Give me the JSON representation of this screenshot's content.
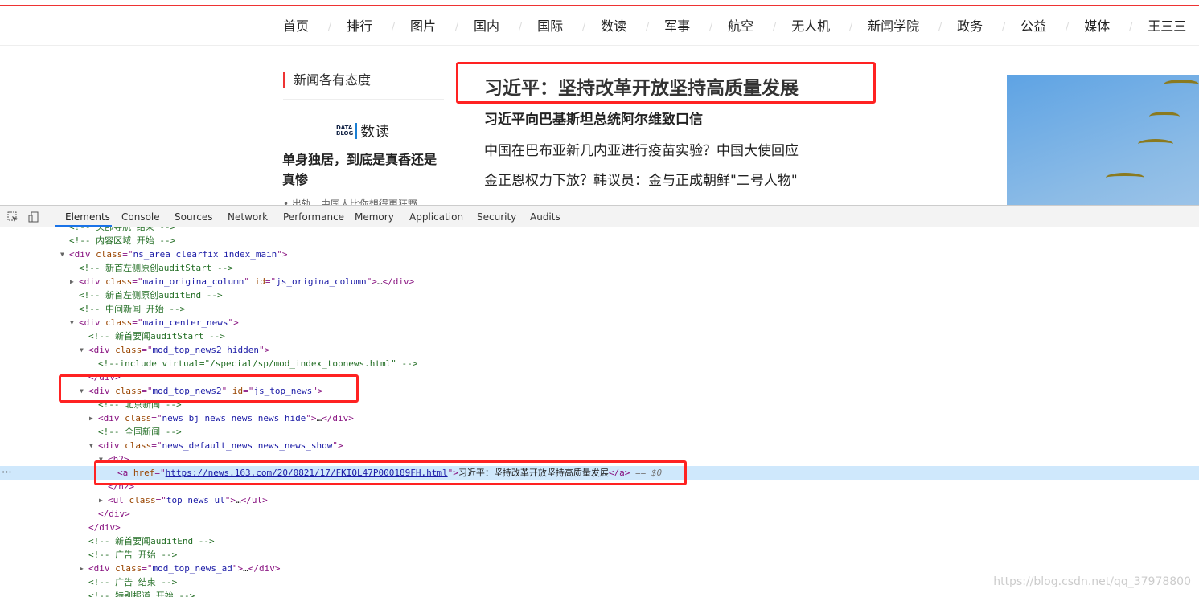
{
  "nav": [
    "首页",
    "排行",
    "图片",
    "国内",
    "国际",
    "数读",
    "军事",
    "航空",
    "无人机",
    "新闻学院",
    "政务",
    "公益",
    "媒体",
    "王三三"
  ],
  "left": {
    "title": "新闻各有态度",
    "logo_text": "DATA BLOG",
    "logo_label": "数读",
    "headline": "单身独居，到底是真香还是真惨",
    "sub": "• 出轨，中国人比你想得更狂野"
  },
  "center": {
    "headline": "习近平：坚持改革开放坚持高质量发展",
    "sub": "习近平向巴基斯坦总统阿尔维致口信",
    "news": [
      "中国在巴布亚新几内亚进行疫苗实验？中国大使回应",
      "金正恩权力下放？韩议员：金与正成朝鲜\"二号人物\""
    ]
  },
  "devtools": {
    "tabs": [
      "Elements",
      "Console",
      "Sources",
      "Network",
      "Performance",
      "Memory",
      "Application",
      "Security",
      "Audits"
    ],
    "active_tab": "Elements"
  },
  "dom_lines": [
    {
      "d": 0,
      "p": [
        [
          "cm",
          "<!-- 头部导航 结束 -->"
        ]
      ]
    },
    {
      "d": 0,
      "p": [
        [
          "cm",
          "<!-- 内容区域 开始 -->"
        ]
      ]
    },
    {
      "d": 0,
      "tri": "open",
      "p": [
        [
          "tag",
          "<div "
        ],
        [
          "attr",
          "class"
        ],
        [
          "tag",
          "=\""
        ],
        [
          "val",
          "ns_area clearfix index_main"
        ],
        [
          "tag",
          "\">"
        ]
      ]
    },
    {
      "d": 1,
      "p": [
        [
          "cm",
          "<!-- 新首左侧原创auditStart -->"
        ]
      ]
    },
    {
      "d": 1,
      "tri": "closed",
      "p": [
        [
          "tag",
          "<div "
        ],
        [
          "attr",
          "class"
        ],
        [
          "tag",
          "=\""
        ],
        [
          "val",
          "main_origina_column"
        ],
        [
          "tag",
          "\" "
        ],
        [
          "attr",
          "id"
        ],
        [
          "tag",
          "=\""
        ],
        [
          "val",
          "js_origina_column"
        ],
        [
          "tag",
          "\">"
        ],
        [
          "tx",
          "…"
        ],
        [
          "tag",
          "</div>"
        ]
      ]
    },
    {
      "d": 1,
      "p": [
        [
          "cm",
          "<!-- 新首左侧原创auditEnd -->"
        ]
      ]
    },
    {
      "d": 1,
      "p": [
        [
          "cm",
          "<!-- 中间新闻 开始 -->"
        ]
      ]
    },
    {
      "d": 1,
      "tri": "open",
      "p": [
        [
          "tag",
          "<div "
        ],
        [
          "attr",
          "class"
        ],
        [
          "tag",
          "=\""
        ],
        [
          "val",
          "main_center_news"
        ],
        [
          "tag",
          "\">"
        ]
      ]
    },
    {
      "d": 2,
      "p": [
        [
          "cm",
          "<!-- 新首要闻auditStart -->"
        ]
      ]
    },
    {
      "d": 2,
      "tri": "open",
      "p": [
        [
          "tag",
          "<div "
        ],
        [
          "attr",
          "class"
        ],
        [
          "tag",
          "=\""
        ],
        [
          "val",
          "mod_top_news2 hidden"
        ],
        [
          "tag",
          "\">"
        ]
      ]
    },
    {
      "d": 3,
      "p": [
        [
          "cm",
          "<!--include virtual=\"/special/sp/mod_index_topnews.html\" -->"
        ]
      ]
    },
    {
      "d": 2,
      "p": [
        [
          "tag",
          "</div>"
        ]
      ]
    },
    {
      "d": 2,
      "tri": "open",
      "p": [
        [
          "tag",
          "<div "
        ],
        [
          "attr",
          "class"
        ],
        [
          "tag",
          "=\""
        ],
        [
          "val",
          "mod_top_news2"
        ],
        [
          "tag",
          "\" "
        ],
        [
          "attr",
          "id"
        ],
        [
          "tag",
          "=\""
        ],
        [
          "val",
          "js_top_news"
        ],
        [
          "tag",
          "\">"
        ]
      ]
    },
    {
      "d": 3,
      "p": [
        [
          "cm",
          "<!-- 北京新闻 -->"
        ]
      ]
    },
    {
      "d": 3,
      "tri": "closed",
      "p": [
        [
          "tag",
          "<div "
        ],
        [
          "attr",
          "class"
        ],
        [
          "tag",
          "=\""
        ],
        [
          "val",
          "news_bj_news news_news_hide"
        ],
        [
          "tag",
          "\">"
        ],
        [
          "tx",
          "…"
        ],
        [
          "tag",
          "</div>"
        ]
      ]
    },
    {
      "d": 3,
      "p": [
        [
          "cm",
          "<!-- 全国新闻 -->"
        ]
      ]
    },
    {
      "d": 3,
      "tri": "open",
      "p": [
        [
          "tag",
          "<div "
        ],
        [
          "attr",
          "class"
        ],
        [
          "tag",
          "=\""
        ],
        [
          "val",
          "news_default_news news_news_show"
        ],
        [
          "tag",
          "\">"
        ]
      ]
    },
    {
      "d": 4,
      "tri": "open",
      "p": [
        [
          "tag",
          "<h2>"
        ]
      ]
    },
    {
      "d": 5,
      "sel": true,
      "p": [
        [
          "tag",
          "<a "
        ],
        [
          "attr",
          "href"
        ],
        [
          "tag",
          "=\""
        ],
        [
          "lk",
          "https://news.163.com/20/0821/17/FKIQL47P000189FH.html"
        ],
        [
          "tag",
          "\">"
        ],
        [
          "tx",
          "习近平：坚持改革开放坚持高质量发展"
        ],
        [
          "tag",
          "</a>"
        ],
        [
          "eq",
          " == $0"
        ]
      ]
    },
    {
      "d": 4,
      "p": [
        [
          "tag",
          "</h2>"
        ]
      ]
    },
    {
      "d": 4,
      "tri": "closed",
      "p": [
        [
          "tag",
          "<ul "
        ],
        [
          "attr",
          "class"
        ],
        [
          "tag",
          "=\""
        ],
        [
          "val",
          "top_news_ul"
        ],
        [
          "tag",
          "\">"
        ],
        [
          "tx",
          "…"
        ],
        [
          "tag",
          "</ul>"
        ]
      ]
    },
    {
      "d": 3,
      "p": [
        [
          "tag",
          "</div>"
        ]
      ]
    },
    {
      "d": 2,
      "p": [
        [
          "tag",
          "</div>"
        ]
      ]
    },
    {
      "d": 2,
      "p": [
        [
          "cm",
          "<!-- 新首要闻auditEnd -->"
        ]
      ]
    },
    {
      "d": 2,
      "p": [
        [
          "cm",
          "<!-- 广告 开始 -->"
        ]
      ]
    },
    {
      "d": 2,
      "tri": "closed",
      "p": [
        [
          "tag",
          "<div "
        ],
        [
          "attr",
          "class"
        ],
        [
          "tag",
          "=\""
        ],
        [
          "val",
          "mod_top_news_ad"
        ],
        [
          "tag",
          "\">"
        ],
        [
          "tx",
          "…"
        ],
        [
          "tag",
          "</div>"
        ]
      ]
    },
    {
      "d": 2,
      "p": [
        [
          "cm",
          "<!-- 广告 结束 -->"
        ]
      ]
    },
    {
      "d": 2,
      "p": [
        [
          "cm",
          "<!-- 特别报道 开始 -->"
        ]
      ]
    }
  ],
  "watermark": "https://blog.csdn.net/qq_37978800",
  "colors": {
    "accent": "#ee3333",
    "highlight_box": "#ff2222",
    "selected_row": "#cfe8fc",
    "devtools_active": "#1a73e8"
  }
}
